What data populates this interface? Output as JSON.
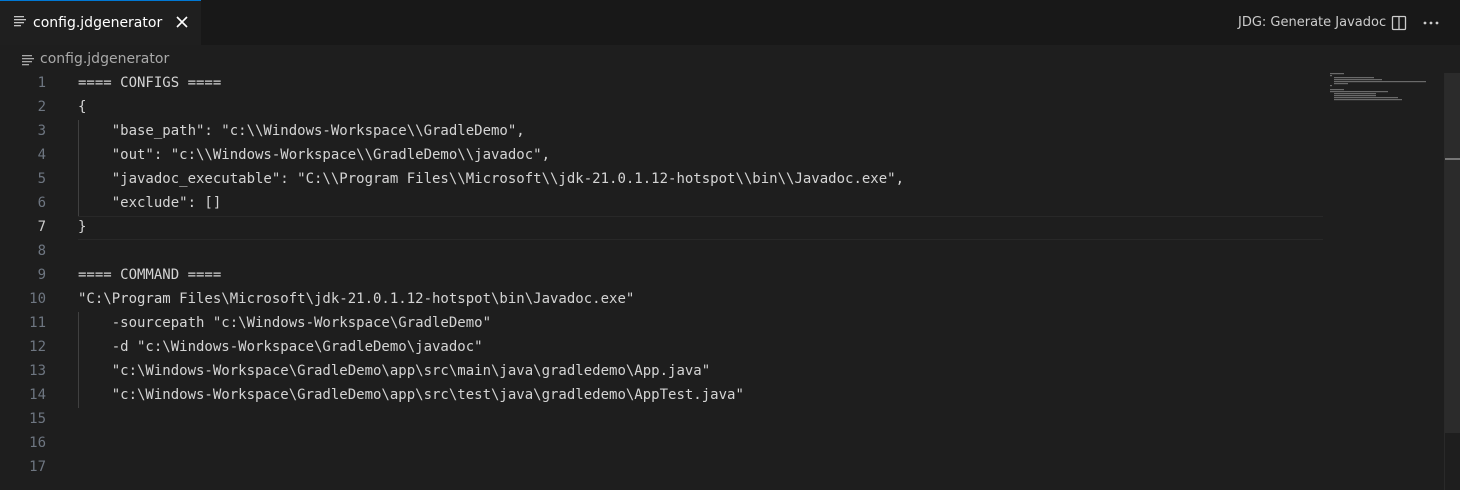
{
  "tab": {
    "label": "config.jdgenerator",
    "icon": "file-lines-icon",
    "close_icon": "close-icon"
  },
  "editor_actions": {
    "label": "JDG: Generate Javadoc",
    "split_icon": "split-editor-icon",
    "more_icon": "more-actions-icon"
  },
  "breadcrumb": {
    "label": "config.jdgenerator",
    "icon": "file-lines-icon"
  },
  "editor": {
    "active_line": 7,
    "lines": [
      {
        "num": "1",
        "text": "==== CONFIGS ===="
      },
      {
        "num": "2",
        "text": "{"
      },
      {
        "num": "3",
        "text": "    \"base_path\": \"c:\\\\Windows-Workspace\\\\GradleDemo\","
      },
      {
        "num": "4",
        "text": "    \"out\": \"c:\\\\Windows-Workspace\\\\GradleDemo\\\\javadoc\","
      },
      {
        "num": "5",
        "text": "    \"javadoc_executable\": \"C:\\\\Program Files\\\\Microsoft\\\\jdk-21.0.1.12-hotspot\\\\bin\\\\Javadoc.exe\","
      },
      {
        "num": "6",
        "text": "    \"exclude\": []"
      },
      {
        "num": "7",
        "text": "}"
      },
      {
        "num": "8",
        "text": ""
      },
      {
        "num": "9",
        "text": "==== COMMAND ===="
      },
      {
        "num": "10",
        "text": "\"C:\\Program Files\\Microsoft\\jdk-21.0.1.12-hotspot\\bin\\Javadoc.exe\""
      },
      {
        "num": "11",
        "text": "    -sourcepath \"c:\\Windows-Workspace\\GradleDemo\""
      },
      {
        "num": "12",
        "text": "    -d \"c:\\Windows-Workspace\\GradleDemo\\javadoc\""
      },
      {
        "num": "13",
        "text": "    \"c:\\Windows-Workspace\\GradleDemo\\app\\src\\main\\java\\gradledemo\\App.java\""
      },
      {
        "num": "14",
        "text": "    \"c:\\Windows-Workspace\\GradleDemo\\app\\src\\test\\java\\gradledemo\\AppTest.java\""
      },
      {
        "num": "15",
        "text": ""
      },
      {
        "num": "16",
        "text": ""
      },
      {
        "num": "17",
        "text": ""
      }
    ]
  },
  "colors": {
    "accent": "#0078d4",
    "editor_bg": "#1e1e1e",
    "tabbar_bg": "#181818",
    "text": "#d4d4d4",
    "line_number": "#6e7681"
  }
}
